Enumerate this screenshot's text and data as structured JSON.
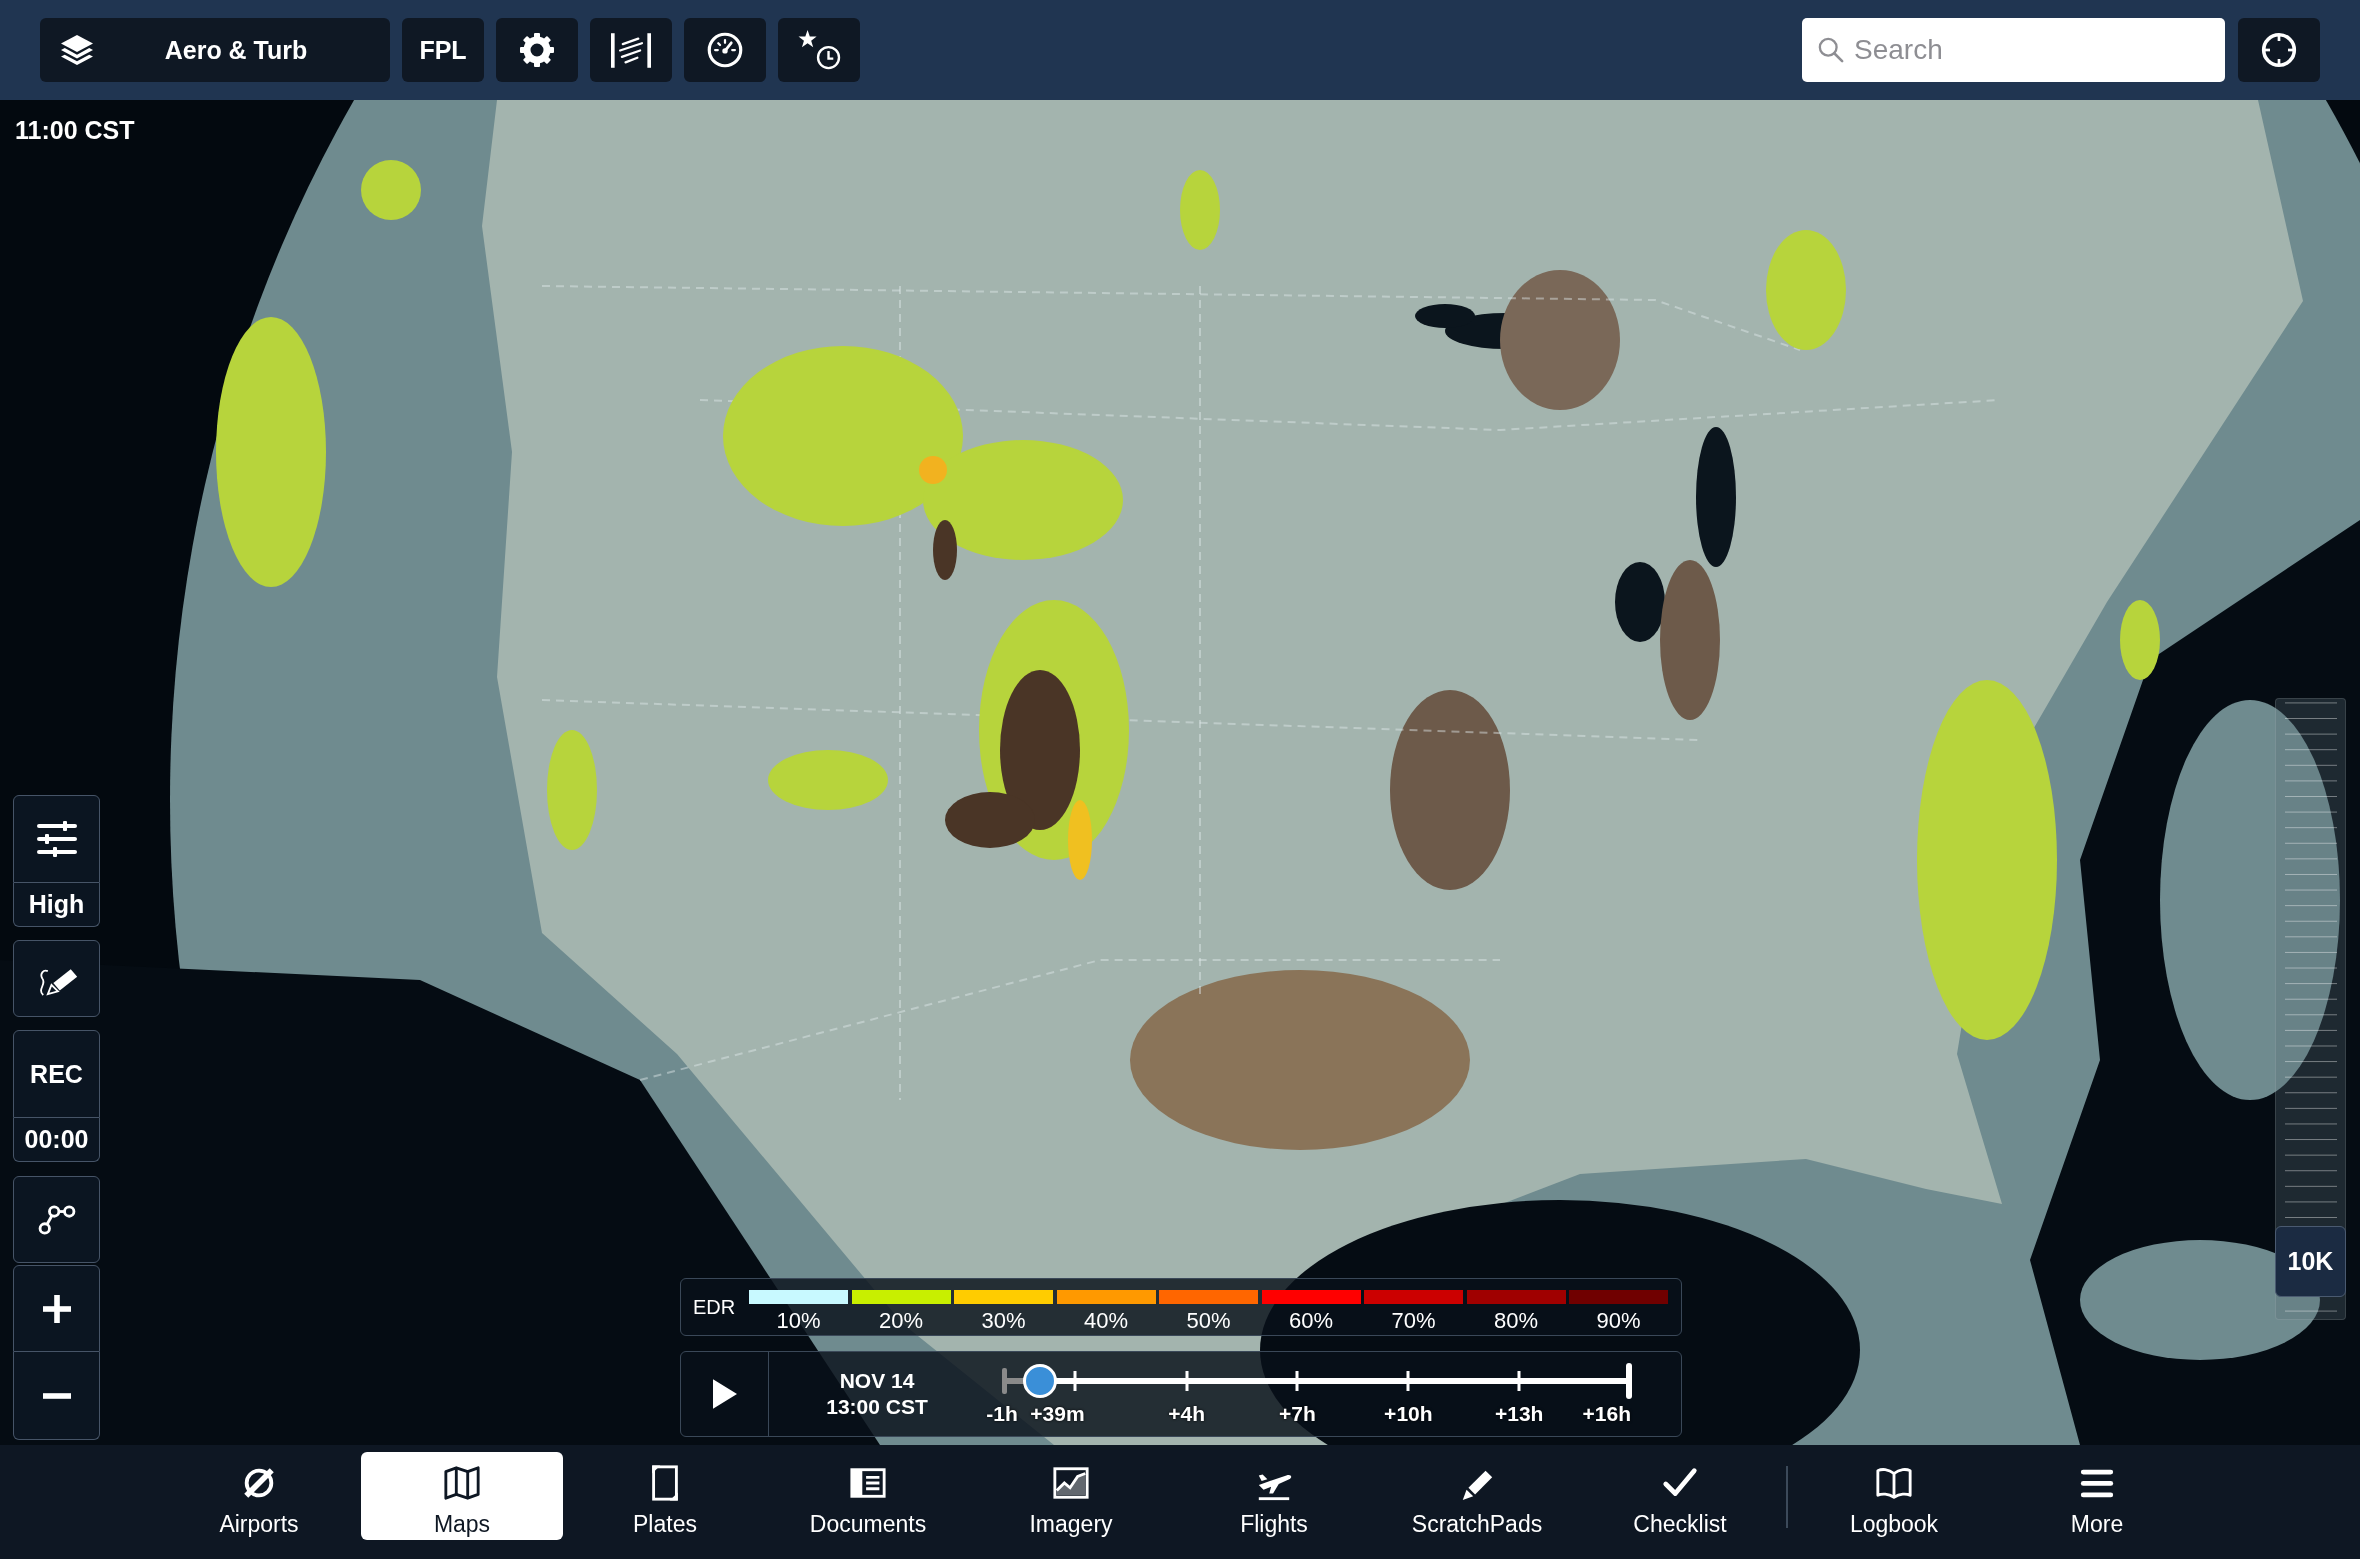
{
  "toolbar": {
    "layers_label": "Aero & Turb",
    "flight_plan_label": "FPL",
    "search": {
      "placeholder": "Search"
    }
  },
  "map": {
    "time": "11:00 CST"
  },
  "map_controls": {
    "detail_level": "High",
    "record_label": "REC",
    "record_time": "00:00"
  },
  "altitude": {
    "level": 0.04,
    "reading": "10K"
  },
  "legend": {
    "title": "EDR",
    "bands": [
      {
        "label": "10%",
        "color": "#c8f9ff"
      },
      {
        "label": "20%",
        "color": "#c8ef00"
      },
      {
        "label": "30%",
        "color": "#ffcc00"
      },
      {
        "label": "40%",
        "color": "#ff9900"
      },
      {
        "label": "50%",
        "color": "#ff6600"
      },
      {
        "label": "60%",
        "color": "#ff0000"
      },
      {
        "label": "70%",
        "color": "#cc0000"
      },
      {
        "label": "80%",
        "color": "#a00000"
      },
      {
        "label": "90%",
        "color": "#700000"
      }
    ]
  },
  "timeline": {
    "date": "NOV 14",
    "time": "13:00 CST",
    "level": 0.06,
    "ticks": [
      "-1h",
      "+39m",
      "+4h",
      "+7h",
      "+10h",
      "+13h",
      "+16h"
    ]
  },
  "tabs": [
    {
      "kind": "airports",
      "label": "Airports",
      "selected": false
    },
    {
      "kind": "maps",
      "label": "Maps",
      "selected": true
    },
    {
      "kind": "plates",
      "label": "Plates",
      "selected": false
    },
    {
      "kind": "documents",
      "label": "Documents",
      "selected": false
    },
    {
      "kind": "imagery",
      "label": "Imagery",
      "selected": false
    },
    {
      "kind": "flights",
      "label": "Flights",
      "selected": false
    },
    {
      "kind": "scratchpads",
      "label": "ScratchPads",
      "selected": false
    },
    {
      "kind": "checklist",
      "label": "Checklist",
      "selected": false
    },
    {
      "kind": "logbook",
      "label": "Logbook",
      "selected": false
    },
    {
      "kind": "more",
      "label": "More",
      "selected": false
    }
  ]
}
